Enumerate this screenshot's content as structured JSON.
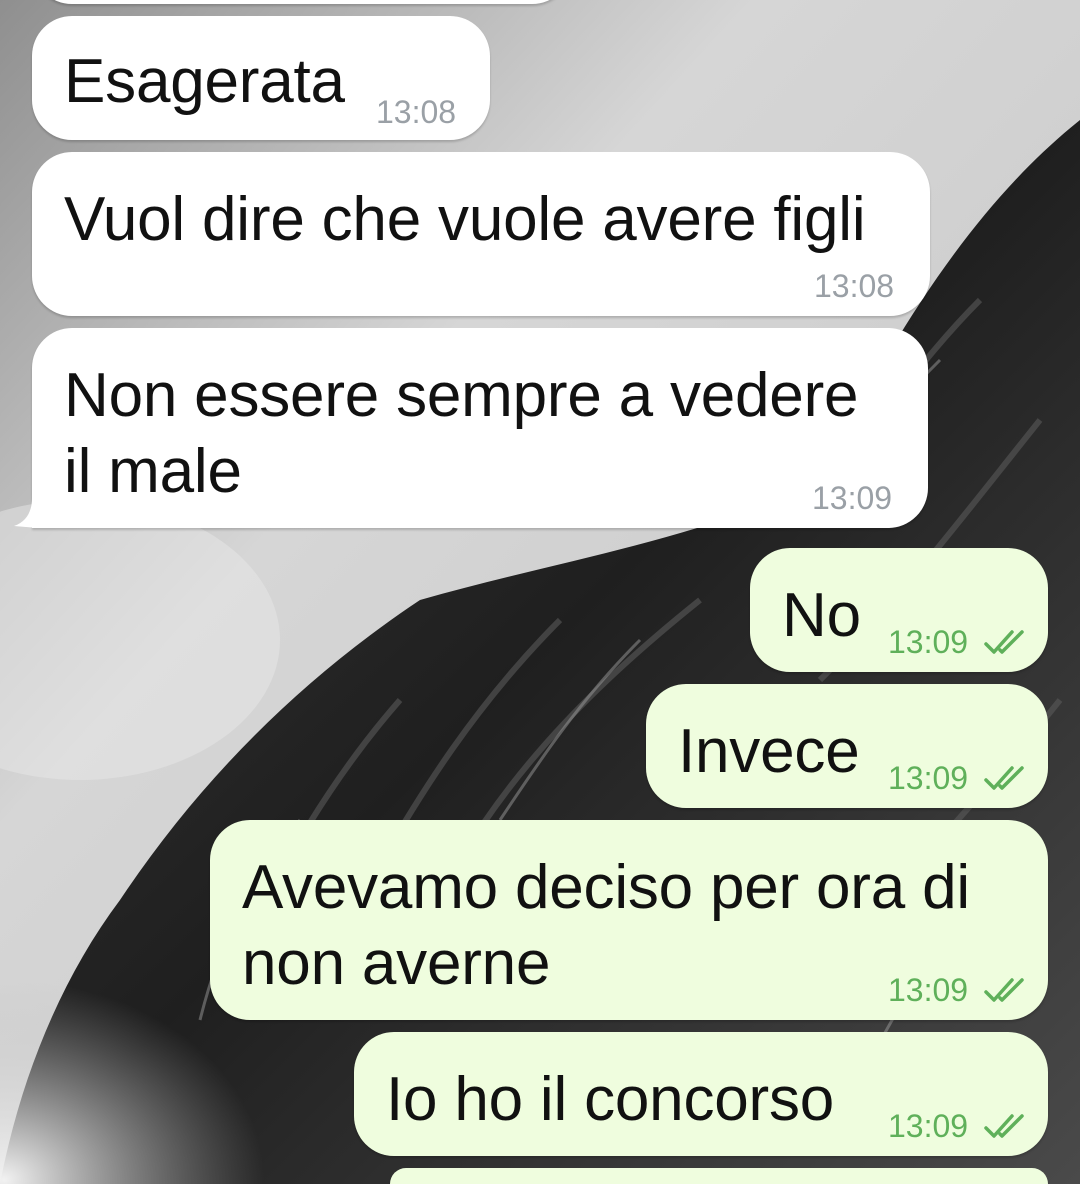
{
  "colors": {
    "incoming_bubble": "#ffffff",
    "outgoing_bubble": "#effdde",
    "outgoing_time": "#5fb05a",
    "incoming_time": "#9aa0a6",
    "wallpaper": "black-and-white ocean wave photo"
  },
  "messages": [
    {
      "direction": "in",
      "lines": [
        "Esagerata"
      ],
      "time": "13:08"
    },
    {
      "direction": "in",
      "lines": [
        "Vuol dire che vuole avere figli"
      ],
      "time": "13:08"
    },
    {
      "direction": "in",
      "lines": [
        "Non essere sempre a vedere",
        "il male"
      ],
      "time": "13:09"
    },
    {
      "direction": "out",
      "lines": [
        "No"
      ],
      "time": "13:09",
      "status_icon": "double-check-icon"
    },
    {
      "direction": "out",
      "lines": [
        "Invece"
      ],
      "time": "13:09",
      "status_icon": "double-check-icon"
    },
    {
      "direction": "out",
      "lines": [
        "Avevamo deciso per ora di",
        "non averne"
      ],
      "time": "13:09",
      "status_icon": "double-check-icon"
    },
    {
      "direction": "out",
      "lines": [
        "Io ho il concorso"
      ],
      "time": "13:09",
      "status_icon": "double-check-icon"
    }
  ]
}
